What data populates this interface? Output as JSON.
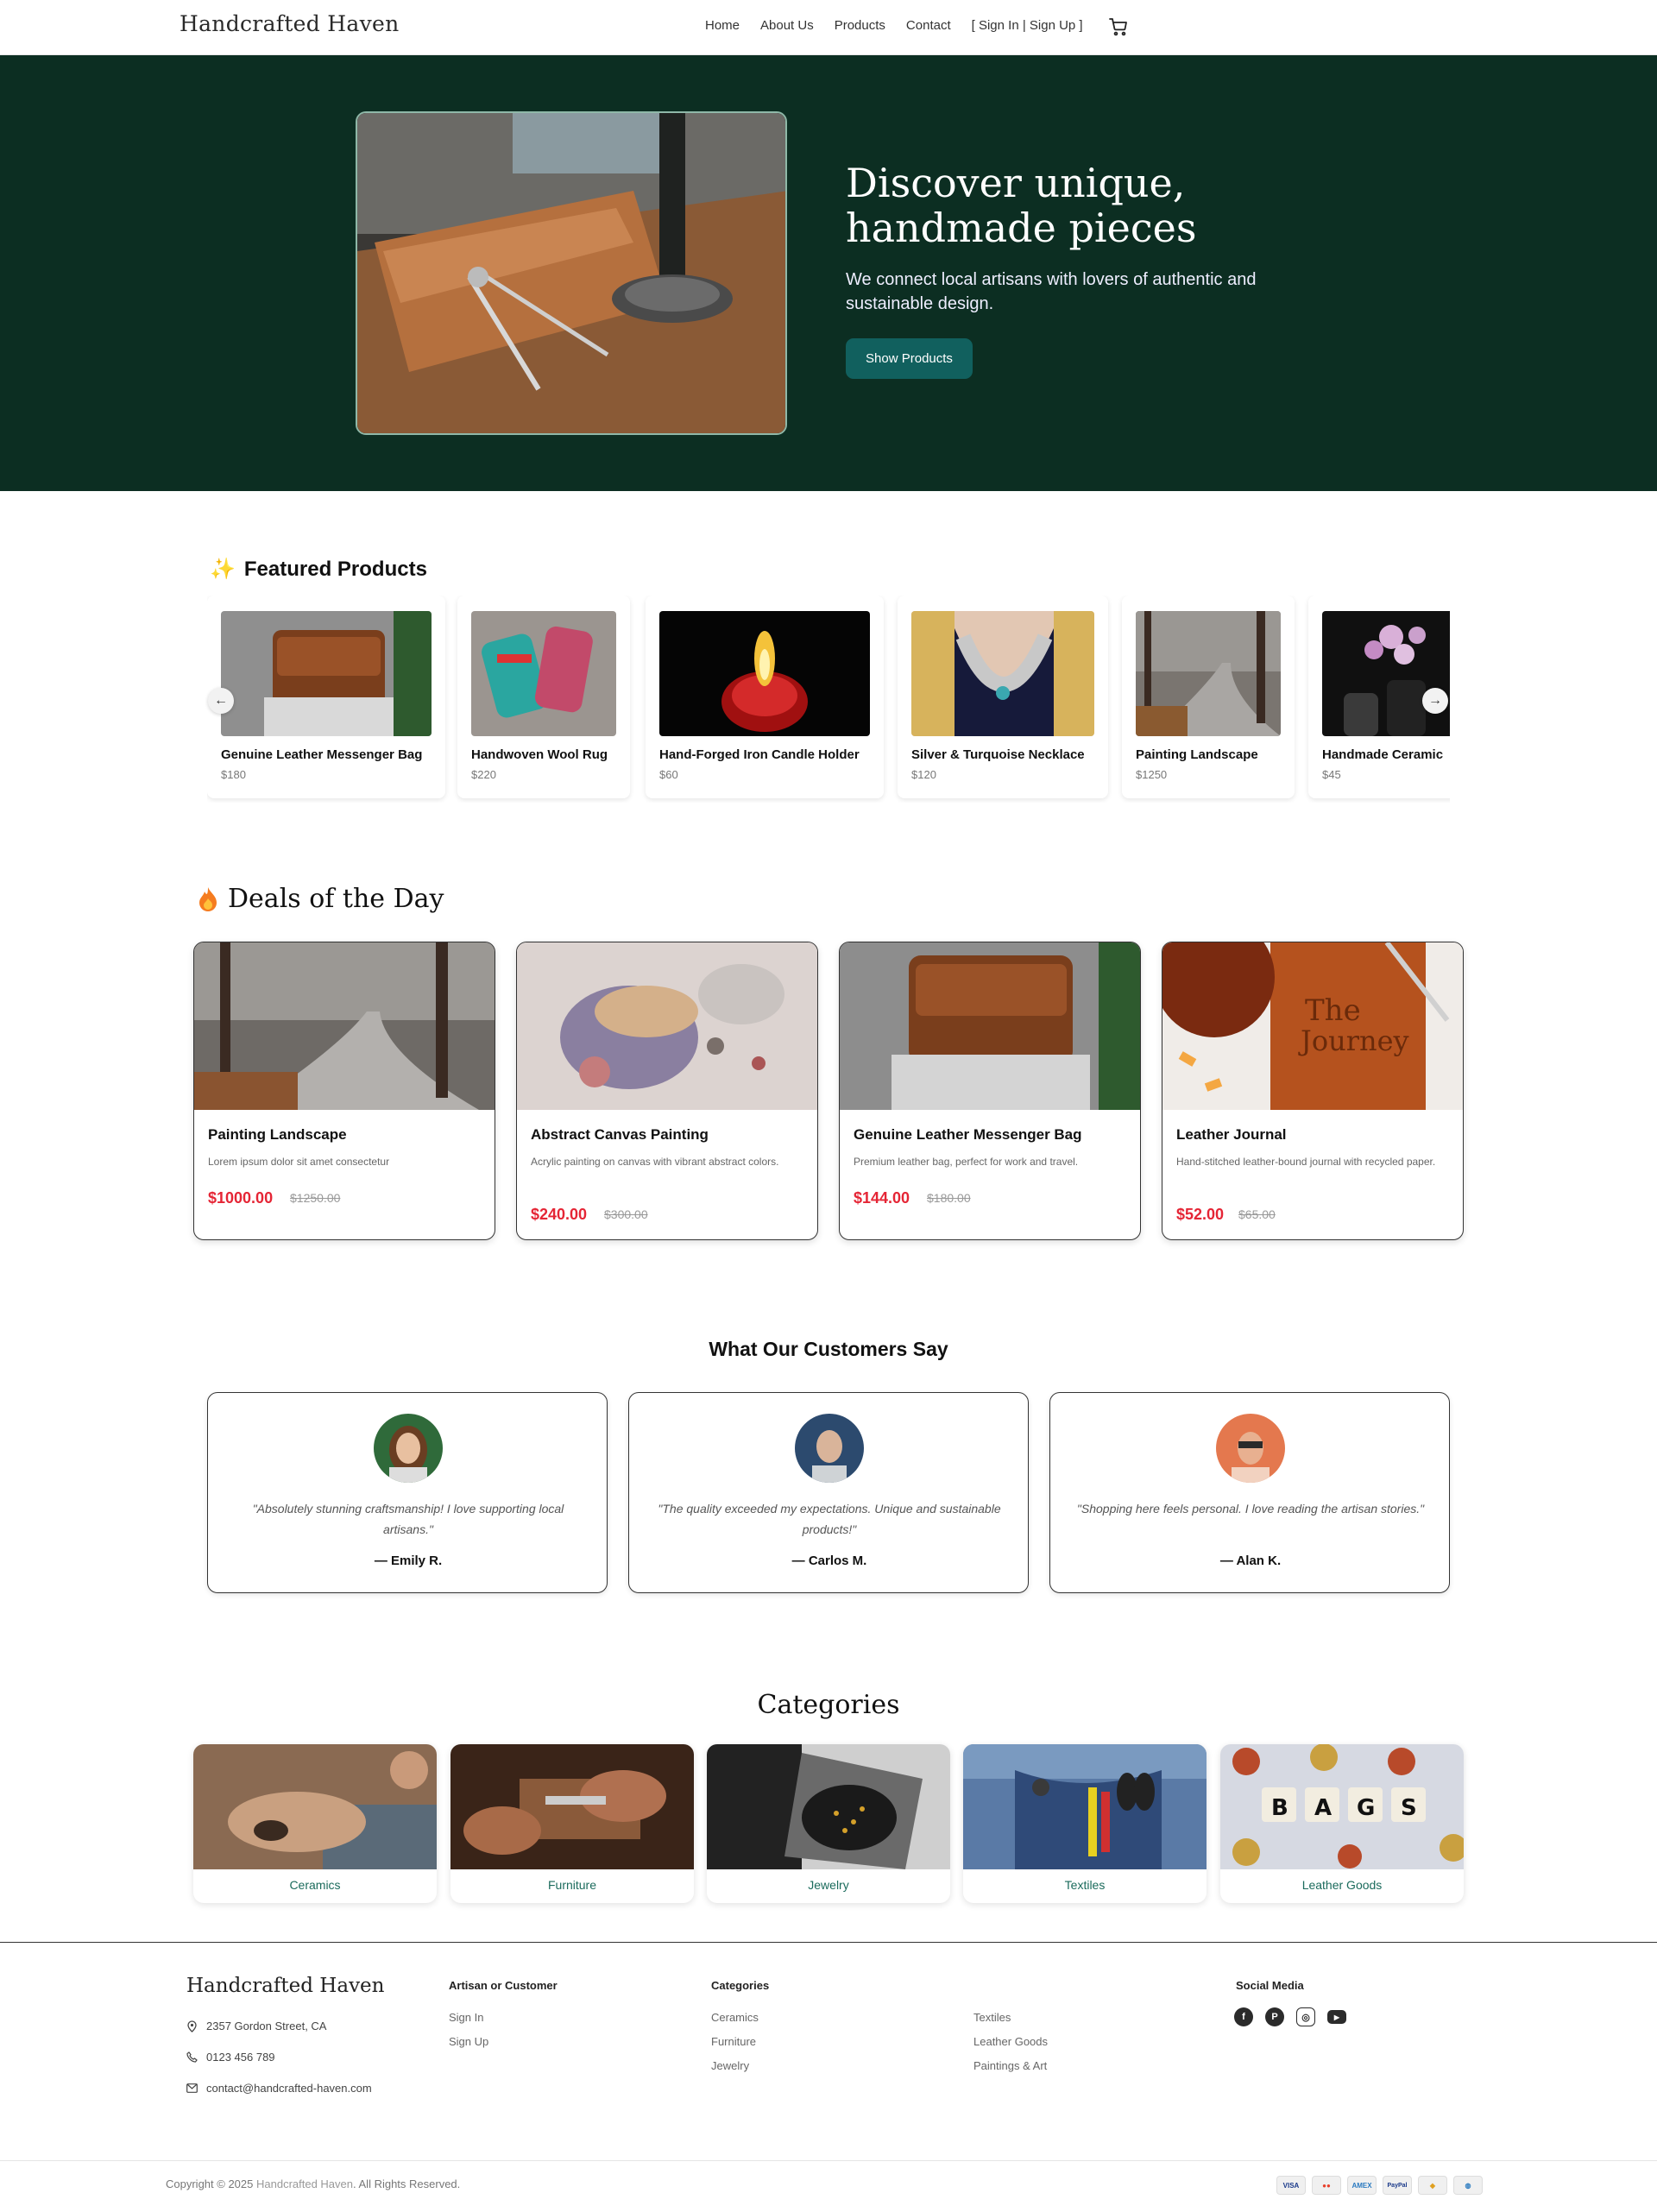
{
  "nav": {
    "brand": "Handcrafted Haven",
    "links": [
      "Home",
      "About Us",
      "Products",
      "Contact",
      "[ Sign In | Sign Up ]"
    ]
  },
  "hero": {
    "title": "Discover unique, handmade pieces",
    "subtitle": "We connect local artisans with lovers of authentic and sustainable design.",
    "button": "Show Products"
  },
  "featured": {
    "icon": "✨",
    "title": "Featured Products",
    "items": [
      {
        "name": "Genuine Leather Messenger Bag",
        "price": "$180"
      },
      {
        "name": "Handwoven Wool Rug",
        "price": "$220"
      },
      {
        "name": "Hand-Forged Iron Candle Holder",
        "price": "$60"
      },
      {
        "name": "Silver & Turquoise Necklace",
        "price": "$120"
      },
      {
        "name": "Painting Landscape",
        "price": "$1250"
      },
      {
        "name": "Handmade Ceramic",
        "price": "$45"
      }
    ],
    "prev": "←",
    "next": "→"
  },
  "deals": {
    "title": "Deals of the Day",
    "items": [
      {
        "name": "Painting Landscape",
        "desc": "Lorem ipsum dolor sit amet consectetur",
        "price": "$1000.00",
        "old": "$1250.00"
      },
      {
        "name": "Abstract Canvas Painting",
        "desc": "Acrylic painting on canvas with vibrant abstract colors.",
        "price": "$240.00",
        "old": "$300.00"
      },
      {
        "name": "Genuine Leather Messenger Bag",
        "desc": "Premium leather bag, perfect for work and travel.",
        "price": "$144.00",
        "old": "$180.00"
      },
      {
        "name": "Leather Journal",
        "desc": "Hand-stitched leather-bound journal with recycled paper.",
        "price": "$52.00",
        "old": "$65.00"
      }
    ]
  },
  "testimonials": {
    "title": "What Our Customers Say",
    "items": [
      {
        "quote": "\"Absolutely stunning craftsmanship! I love supporting local artisans.\"",
        "name": "— Emily R."
      },
      {
        "quote": "\"The quality exceeded my expectations. Unique and sustainable products!\"",
        "name": "— Carlos M."
      },
      {
        "quote": "\"Shopping here feels personal. I love reading the artisan stories.\"",
        "name": "— Alan K."
      }
    ]
  },
  "categories": {
    "title": "Categories",
    "items": [
      "Ceramics",
      "Furniture",
      "Jewelry",
      "Textiles",
      "Leather Goods"
    ],
    "bags_letters": [
      "B",
      "A",
      "G",
      "S"
    ]
  },
  "footer": {
    "brand": "Handcrafted Haven",
    "address": "2357 Gordon Street, CA",
    "phone": "0123 456 789",
    "email": "contact@handcrafted-haven.com",
    "col1_title": "Artisan or Customer",
    "col1_links": [
      "Sign In",
      "Sign Up"
    ],
    "col2_title": "Categories",
    "col2_links": [
      "Ceramics",
      "Furniture",
      "Jewelry"
    ],
    "col3_links": [
      "Textiles",
      "Leather Goods",
      "Paintings & Art"
    ],
    "social_title": "Social Media",
    "social_icons": [
      "f",
      "P",
      "◎",
      "▶"
    ],
    "copyright_pre": "Copyright © 2025",
    "copyright_brand": "Handcrafted Haven",
    "copyright_post": ". All Rights Reserved.",
    "payments": [
      "VISA",
      "●●",
      "AMEX",
      "PayPal",
      "◆",
      "◍"
    ]
  },
  "colors": {
    "hero_bg": "#0c2e22",
    "button": "#11605e",
    "deal_price": "#e52535",
    "category_label": "#1b6b5c"
  }
}
